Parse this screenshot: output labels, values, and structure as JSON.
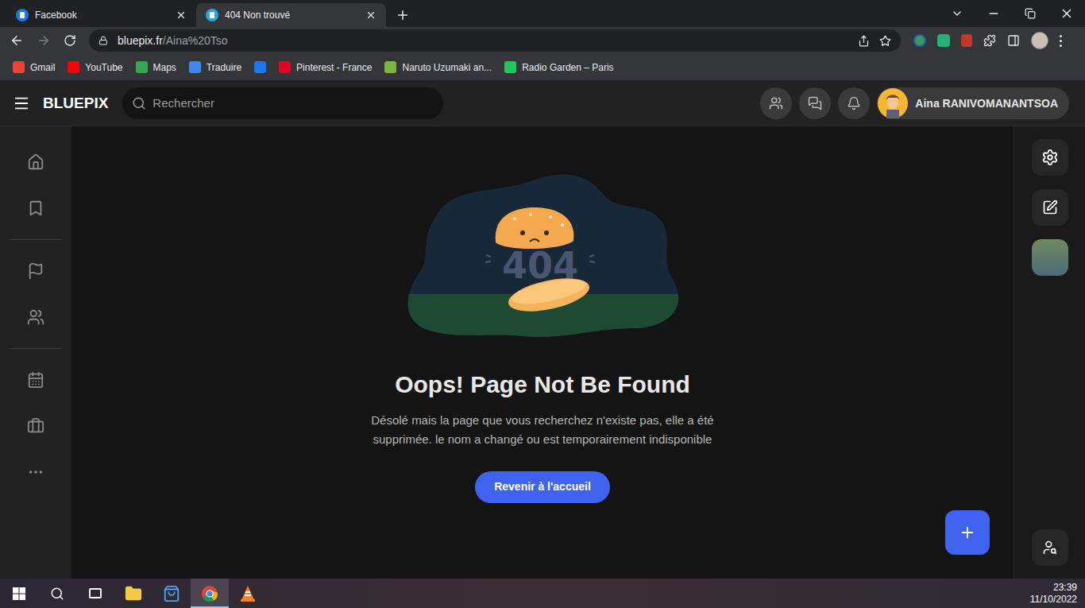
{
  "browser": {
    "tabs": [
      {
        "label": "Facebook",
        "selected": false,
        "color": "#1877f2"
      },
      {
        "label": "404 Non trouvé",
        "selected": true,
        "color": "#29a8e0"
      }
    ],
    "address": {
      "domain": "bluepix.fr",
      "path": "/Aina%20Tso"
    },
    "bookmarks": [
      {
        "kind": "link",
        "label": "Gmail",
        "color": "#ea4335"
      },
      {
        "kind": "link",
        "label": "YouTube",
        "color": "#ff0000"
      },
      {
        "kind": "link",
        "label": "Maps",
        "color": "#34a853"
      },
      {
        "kind": "link",
        "label": "Traduire",
        "color": "#4285f4"
      },
      {
        "kind": "icon",
        "color": "#1877f2"
      },
      {
        "kind": "link",
        "label": "Pinterest - France",
        "color": "#e60023"
      },
      {
        "kind": "link",
        "label": "Naruto Uzumaki an...",
        "color": "#7cb342"
      },
      {
        "kind": "link",
        "label": "Radio Garden – Paris",
        "color": "#22c55e"
      }
    ]
  },
  "site": {
    "logo": "BLUEPIX",
    "search": {
      "placeholder": "Rechercher"
    },
    "user": {
      "name": "Aina RANIVOMANANTSOA"
    }
  },
  "error": {
    "code": "404",
    "title": "Oops! Page Not Be Found",
    "message": "Désolé mais la page que vous recherchez n'existe pas, elle a été supprimée. le nom a changé ou est temporairement indisponible",
    "button": "Revenir à l'accueil"
  },
  "taskbar": {
    "apps": [
      {
        "name": "explorer",
        "selected": false
      },
      {
        "name": "store",
        "selected": false
      },
      {
        "name": "chrome",
        "selected": true
      },
      {
        "name": "vlc",
        "selected": false
      }
    ],
    "time": "23:39",
    "date": "11/10/2022"
  }
}
